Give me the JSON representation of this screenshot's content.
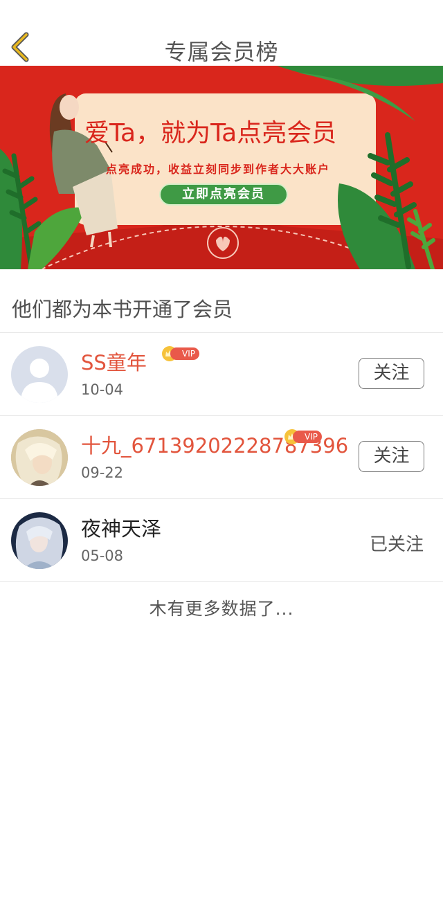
{
  "header": {
    "title": "专属会员榜",
    "back_icon": "chevron-left-icon",
    "back_color": "#e8b820"
  },
  "banner": {
    "headline": "爱Ta，就为Ta点亮会员",
    "subline": "点亮成功，收益立刻同步到作者大大账户",
    "button_label": "立即点亮会员",
    "bg_color": "#d9261c",
    "card_color": "#fbe3c8",
    "button_color": "#3f9a45"
  },
  "section_title": "他们都为本书开通了会员",
  "members": [
    {
      "name": "SS童年",
      "vip": true,
      "vip_label": "VIP",
      "date": "10-04",
      "action": "关注",
      "followed": false
    },
    {
      "name": "十九_67139202228787396",
      "vip": true,
      "vip_label": "VIP",
      "date": "09-22",
      "action": "关注",
      "followed": false
    },
    {
      "name": "夜神天泽",
      "vip": false,
      "date": "05-08",
      "action": "已关注",
      "followed": true
    }
  ],
  "footer_text": "木有更多数据了..."
}
